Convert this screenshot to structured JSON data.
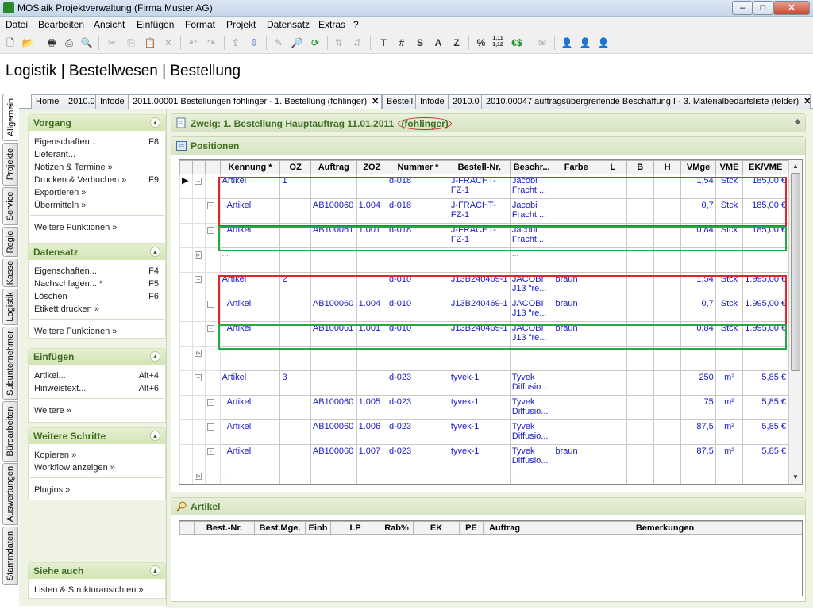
{
  "window": {
    "title": "MOS'aik Projektverwaltung (Firma Muster AG)",
    "minimize": "–",
    "maximize": "□",
    "close": "✕"
  },
  "menu": [
    "Datei",
    "Bearbeiten",
    "Ansicht",
    "Einfügen",
    "Format",
    "Projekt",
    "Datensatz",
    "Extras",
    "?"
  ],
  "toolbar_text": [
    "T",
    "#",
    "S",
    "A",
    "Z",
    "%",
    "1,11\n1,12",
    "€$"
  ],
  "page_title": "Logistik | Bestellwesen | Bestellung",
  "vtabs": [
    "Allgemein",
    "Projekte",
    "Service",
    "Regie",
    "Kasse",
    "Logistik",
    "Subunternehmer",
    "Büroarbeiten",
    "Auswertungen",
    "Stammdaten"
  ],
  "doc_tabs": [
    {
      "label": "Home"
    },
    {
      "label": "2010.0"
    },
    {
      "label": "Infode"
    },
    {
      "label": "2011.00001 Bestellungen fohlinger - 1. Bestellung (fohlinger)",
      "close": "✕"
    },
    {
      "label": "Bestell"
    },
    {
      "label": "Infode"
    },
    {
      "label": "2010.0"
    },
    {
      "label": "2010.00047 auftragsübergreifende Beschaffung I - 3. Materialbedarfsliste (felder)",
      "close": "✕"
    }
  ],
  "panel": {
    "vorgang": {
      "title": "Vorgang",
      "items": [
        {
          "label": "Eigenschaften...",
          "key": "F8"
        },
        {
          "label": "Lieferant..."
        },
        {
          "label": "Notizen & Termine »"
        },
        {
          "label": "Drucken & Verbuchen »",
          "key": "F9"
        },
        {
          "label": "Exportieren »"
        },
        {
          "label": "Übermitteln »"
        }
      ],
      "more": "Weitere Funktionen »"
    },
    "datensatz": {
      "title": "Datensatz",
      "items": [
        {
          "label": "Eigenschaften...",
          "key": "F4"
        },
        {
          "label": "Nachschlagen... *",
          "key": "F5"
        },
        {
          "label": "Löschen",
          "key": "F6"
        },
        {
          "label": "Etikett drucken »"
        }
      ],
      "more": "Weitere Funktionen »"
    },
    "einfuegen": {
      "title": "Einfügen",
      "items": [
        {
          "label": "Artikel...",
          "key": "Alt+4"
        },
        {
          "label": "Hinweistext...",
          "key": "Alt+6"
        }
      ],
      "more": "Weitere »"
    },
    "schritte": {
      "title": "Weitere Schritte",
      "items": [
        {
          "label": "Kopieren »"
        },
        {
          "label": "Workflow anzeigen »"
        }
      ],
      "more": "Plugins »"
    },
    "siehe": {
      "title": "Siehe auch",
      "items": [
        {
          "label": "Listen & Strukturansichten »"
        }
      ]
    }
  },
  "zweig": {
    "title": "Zweig: 1. Bestellung Hauptauftrag 11.01.2011",
    "owner": "(fohlinger)"
  },
  "positionen": {
    "title": "Positionen",
    "columns": [
      "Kennung *",
      "OZ",
      "Auftrag",
      "ZOZ",
      "Nummer *",
      "Bestell-Nr.",
      "Beschr...",
      "Farbe",
      "L",
      "B",
      "H",
      "VMge",
      "VME",
      "EK/VME"
    ],
    "rows": [
      {
        "kennung": "Artikel",
        "oz": "1",
        "auftrag": "",
        "zoz": "",
        "nummer": "d-018",
        "bestellnr": "J-FRACHT-FZ-1",
        "beschr": "Jacobi Fracht ...",
        "farbe": "",
        "vmge": "1,54",
        "vme": "Stck",
        "ek": "185,00 €",
        "child": false,
        "current": true
      },
      {
        "kennung": "Artikel",
        "oz": "",
        "auftrag": "AB100060",
        "zoz": "1.004",
        "nummer": "d-018",
        "bestellnr": "J-FRACHT-FZ-1",
        "beschr": "Jacobi Fracht ...",
        "farbe": "",
        "vmge": "0,7",
        "vme": "Stck",
        "ek": "185,00 €",
        "child": true
      },
      {
        "kennung": "Artikel",
        "oz": "",
        "auftrag": "AB100061",
        "zoz": "1.001",
        "nummer": "d-018",
        "bestellnr": "J-FRACHT-FZ-1",
        "beschr": "Jacobi Fracht ...",
        "farbe": "",
        "vmge": "0,84",
        "vme": "Stck",
        "ek": "185,00 €",
        "child": true
      },
      {
        "dots": true
      },
      {
        "kennung": "Artikel",
        "oz": "2",
        "auftrag": "",
        "zoz": "",
        "nummer": "d-010",
        "bestellnr": "J13B240469-1",
        "beschr": "JACOBI J13 \"re...",
        "farbe": "braun",
        "vmge": "1,54",
        "vme": "Stck",
        "ek": "1.995,00 €",
        "child": false
      },
      {
        "kennung": "Artikel",
        "oz": "",
        "auftrag": "AB100060",
        "zoz": "1.004",
        "nummer": "d-010",
        "bestellnr": "J13B240469-1",
        "beschr": "JACOBI J13 \"re...",
        "farbe": "braun",
        "vmge": "0,7",
        "vme": "Stck",
        "ek": "1.995,00 €",
        "child": true
      },
      {
        "kennung": "Artikel",
        "oz": "",
        "auftrag": "AB100061",
        "zoz": "1.001",
        "nummer": "d-010",
        "bestellnr": "J13B240469-1",
        "beschr": "JACOBI J13 \"re...",
        "farbe": "braun",
        "vmge": "0,84",
        "vme": "Stck",
        "ek": "1.995,00 €",
        "child": true
      },
      {
        "dots": true
      },
      {
        "kennung": "Artikel",
        "oz": "3",
        "auftrag": "",
        "zoz": "",
        "nummer": "d-023",
        "bestellnr": "tyvek-1",
        "beschr": "Tyvek Diffusio...",
        "farbe": "",
        "vmge": "250",
        "vme": "m²",
        "ek": "5,85 €",
        "child": false
      },
      {
        "kennung": "Artikel",
        "oz": "",
        "auftrag": "AB100060",
        "zoz": "1.005",
        "nummer": "d-023",
        "bestellnr": "tyvek-1",
        "beschr": "Tyvek Diffusio...",
        "farbe": "",
        "vmge": "75",
        "vme": "m²",
        "ek": "5,85 €",
        "child": true
      },
      {
        "kennung": "Artikel",
        "oz": "",
        "auftrag": "AB100060",
        "zoz": "1.006",
        "nummer": "d-023",
        "bestellnr": "tyvek-1",
        "beschr": "Tyvek Diffusio...",
        "farbe": "",
        "vmge": "87,5",
        "vme": "m²",
        "ek": "5,85 €",
        "child": true
      },
      {
        "kennung": "Artikel",
        "oz": "",
        "auftrag": "AB100060",
        "zoz": "1.007",
        "nummer": "d-023",
        "bestellnr": "tyvek-1",
        "beschr": "Tyvek Diffusio...",
        "farbe": "braun",
        "vmge": "87,5",
        "vme": "m²",
        "ek": "5,85 €",
        "child": true
      },
      {
        "dots": true
      }
    ]
  },
  "artikel": {
    "title": "Artikel",
    "columns": [
      "Best.-Nr.",
      "Best.Mge.",
      "Einh",
      "LP",
      "Rab%",
      "EK",
      "PE",
      "Auftrag",
      "Bemerkungen"
    ]
  },
  "colors": {
    "accent_green": "#3f6f21",
    "highlight_red": "#e0262b",
    "highlight_green": "#27a845",
    "link_blue": "#1a1ac8"
  }
}
